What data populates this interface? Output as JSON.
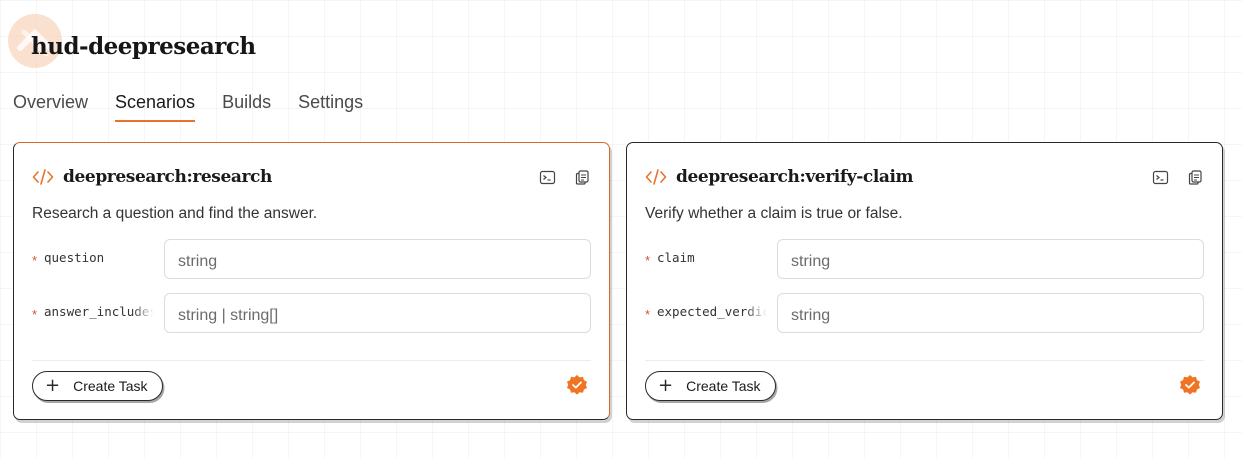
{
  "project": {
    "title": "hud-deepresearch"
  },
  "tabs": [
    {
      "label": "Overview"
    },
    {
      "label": "Scenarios"
    },
    {
      "label": "Builds"
    },
    {
      "label": "Settings"
    }
  ],
  "active_tab": "Scenarios",
  "scenarios": [
    {
      "name": "deepresearch:research",
      "description": "Research a question and find the answer.",
      "params": [
        {
          "name": "question",
          "placeholder": "string",
          "required": true
        },
        {
          "name": "answer_includes",
          "placeholder": "string | string[]",
          "required": true
        }
      ],
      "create_label": "Create Task"
    },
    {
      "name": "deepresearch:verify-claim",
      "description": "Verify whether a claim is true or false.",
      "params": [
        {
          "name": "claim",
          "placeholder": "string",
          "required": true
        },
        {
          "name": "expected_verdict",
          "placeholder": "string",
          "required": true
        }
      ],
      "create_label": "Create Task"
    }
  ],
  "required_marker": "*",
  "colors": {
    "accent": "#e8732c",
    "badge": "#f07422",
    "logo": "#f6c7a8"
  },
  "icons": {
    "code": "code-brackets-icon",
    "terminal": "terminal-icon",
    "copy": "copy-icon",
    "verified": "verified-badge-icon",
    "plus": "plus-icon",
    "logo": "hud-logo-icon"
  }
}
